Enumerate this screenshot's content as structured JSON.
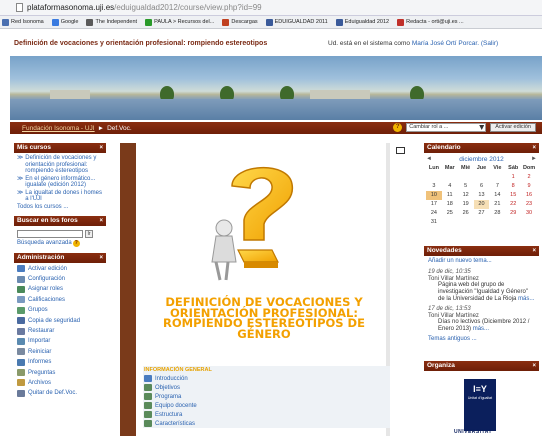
{
  "browser": {
    "url_host": "plataformasonoma.uji.es",
    "url_path": "/eduigualdad2012/course/view.php?id=99",
    "bookmarks": [
      {
        "label": "Red Isonoma",
        "color": "#4a6fb0"
      },
      {
        "label": "Google",
        "color": "#3a7be0"
      },
      {
        "label": "The Independent",
        "color": "#5a5a5a"
      },
      {
        "label": "PAULA > Recursos del...",
        "color": "#2a9a2a"
      },
      {
        "label": "Descargas",
        "color": "#c04020"
      },
      {
        "label": "EDUIGUALDAD 2011",
        "color": "#3a5a9a"
      },
      {
        "label": "Eduigualdad 2012",
        "color": "#3a5a9a"
      },
      {
        "label": "Redacta - orti@uji.es ...",
        "color": "#c0302a"
      }
    ]
  },
  "header": {
    "course_title": "Definición de vocaciones y orientación profesional: rompiendo estereotipos",
    "login_prefix": "Ud. está en el sistema como",
    "login_user": "María José Ortí Porcar. (Salir)"
  },
  "navbar": {
    "breadcrumb_home": "Fundación Isonoma - UJI",
    "breadcrumb_sep": "►",
    "breadcrumb_current": "Def.Voc.",
    "role_select": "Cambiar rol a ...",
    "activate_button": "Activar edición"
  },
  "left": {
    "my_courses": {
      "title": "Mis cursos",
      "items": [
        "Definición de vocaciones y orientación profesional: rompiendo estereotipos",
        "En el género informático... igualate (edición 2012)",
        "La igualtat de dones i homes a l'UJI"
      ],
      "all_label": "Todos los cursos ..."
    },
    "search_forums": {
      "title": "Buscar en los foros",
      "go_label": "Ir",
      "advanced_label": "Búsqueda avanzada"
    },
    "admin": {
      "title": "Administración",
      "items": [
        {
          "label": "Activar edición",
          "color": "#4a7cc0"
        },
        {
          "label": "Configuración",
          "color": "#6a8ab0"
        },
        {
          "label": "Asignar roles",
          "color": "#4a8a5a"
        },
        {
          "label": "Calificaciones",
          "color": "#7a9ac0"
        },
        {
          "label": "Grupos",
          "color": "#5a9a6a"
        },
        {
          "label": "Copia de seguridad",
          "color": "#4a6aa0"
        },
        {
          "label": "Restaurar",
          "color": "#6a7aa0"
        },
        {
          "label": "Importar",
          "color": "#5a8ab0"
        },
        {
          "label": "Reiniciar",
          "color": "#7a8aa0"
        },
        {
          "label": "Informes",
          "color": "#4a7ab0"
        },
        {
          "label": "Preguntas",
          "color": "#8a9a6a"
        },
        {
          "label": "Archivos",
          "color": "#c09a40"
        },
        {
          "label": "Quitar de Def.Voc.",
          "color": "#6a7a9a"
        }
      ]
    }
  },
  "center": {
    "big_title": "DEFINICIÓN DE VOCACIONES Y ORIENTACIÓN PROFESIONAL: ROMPIENDO ESTEREOTIPOS DE GÉNERO",
    "general_info_header": "INFORMACIÓN GENERAL",
    "general_items": [
      {
        "label": "Introducción",
        "color": "#4a7cc0"
      },
      {
        "label": "Objetivos",
        "color": "#5a8a5a"
      },
      {
        "label": "Programa",
        "color": "#5a8a5a"
      },
      {
        "label": "Equipo docente",
        "color": "#5a8a5a"
      },
      {
        "label": "Estructura",
        "color": "#5a8a5a"
      },
      {
        "label": "Características",
        "color": "#5a8a5a"
      }
    ]
  },
  "right": {
    "calendar": {
      "title": "Calendario",
      "month": "diciembre 2012",
      "prev": "◄",
      "next": "►",
      "weekdays": [
        "Lun",
        "Mar",
        "Mié",
        "Jue",
        "Vie",
        "Sáb",
        "Dom"
      ],
      "days": [
        "",
        "",
        "",
        "",
        "",
        "1",
        "2",
        "3",
        "4",
        "5",
        "6",
        "7",
        "8",
        "9",
        "10",
        "11",
        "12",
        "13",
        "14",
        "15",
        "16",
        "17",
        "18",
        "19",
        "20",
        "21",
        "22",
        "23",
        "24",
        "25",
        "26",
        "27",
        "28",
        "29",
        "30",
        "31",
        "",
        "",
        "",
        "",
        "",
        ""
      ],
      "today": "10",
      "highlighted": [
        "20"
      ]
    },
    "news": {
      "title": "Novedades",
      "add_label": "Añadir un nuevo tema...",
      "posts": [
        {
          "date": "19 de dic, 10:35",
          "author": "Toni Villar Martínez",
          "text": "Página web del grupo de investigación \"Igualdad y Género\" de la Universidad de La Rioja",
          "more": "más..."
        },
        {
          "date": "17 de dic, 13:53",
          "author": "Toni Villar Martínez",
          "text": "Días no lectivos (Diciembre 2012 / Enero 2013)",
          "more": "más..."
        }
      ],
      "older_label": "Temas antiguos ..."
    },
    "organiza": {
      "title": "Organiza",
      "logo_small": "Unitat d'Igualtat",
      "logo_text": "UNIVERSITAT"
    }
  }
}
